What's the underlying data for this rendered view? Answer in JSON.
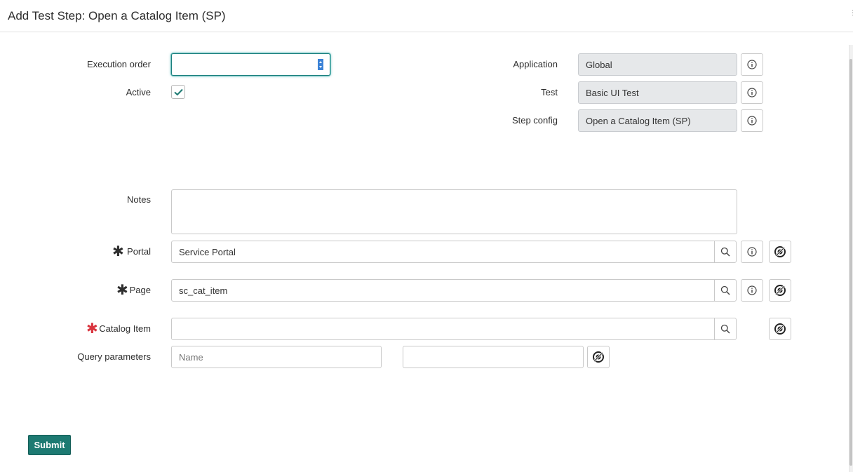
{
  "modal": {
    "title": "Add Test Step: Open a Catalog Item (SP)"
  },
  "fields": {
    "execution_order": {
      "label": "Execution order",
      "value": ""
    },
    "active": {
      "label": "Active",
      "checked": true
    },
    "application": {
      "label": "Application",
      "value": "Global"
    },
    "test": {
      "label": "Test",
      "value": "Basic UI Test"
    },
    "step_config": {
      "label": "Step config",
      "value": "Open a Catalog Item (SP)"
    },
    "notes": {
      "label": "Notes",
      "value": ""
    },
    "portal": {
      "label": "Portal",
      "value": "Service Portal",
      "required_mark": "✱"
    },
    "page": {
      "label": "Page",
      "value": "sc_cat_item",
      "required_mark": "✱"
    },
    "catalog_item": {
      "label": "Catalog Item",
      "value": "",
      "required_mark": "✱"
    },
    "query_parameters": {
      "label": "Query parameters",
      "name_placeholder": "Name",
      "value": ""
    }
  },
  "actions": {
    "submit_label": "Submit"
  },
  "colors": {
    "accent": "#1d7a72",
    "required_unfilled": "#d9343e",
    "required_filled": "#2e2e2e",
    "readonly_bg": "#e6e8ea"
  },
  "icons": [
    "info-icon",
    "search-icon",
    "dependency-icon",
    "checkmark-icon",
    "more-options-icon"
  ]
}
